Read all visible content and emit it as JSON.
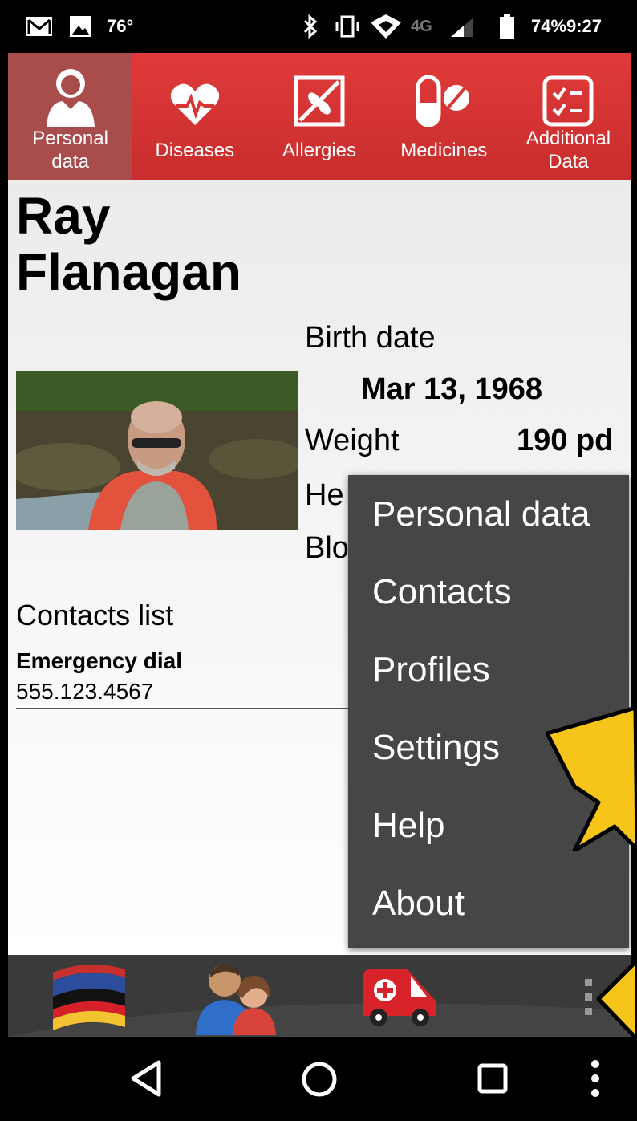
{
  "status": {
    "temperature": "76°",
    "network": "4G",
    "battery": "74%",
    "time": "9:27"
  },
  "tabs": [
    {
      "label": "Personal\ndata",
      "icon": "person-icon"
    },
    {
      "label": "Diseases",
      "icon": "heart-icon"
    },
    {
      "label": "Allergies",
      "icon": "allergy-icon"
    },
    {
      "label": "Medicines",
      "icon": "pill-icon"
    },
    {
      "label": "Additional\nData",
      "icon": "checklist-icon"
    }
  ],
  "profile": {
    "name_first": "Ray",
    "name_last": "Flanagan",
    "birth_label": "Birth date",
    "birth_value": "Mar 13, 1968",
    "weight_label": "Weight",
    "weight_value": "190 pd",
    "height_label_partial": "He",
    "blood_label_partial": "Blo"
  },
  "contacts": {
    "heading": "Contacts list",
    "emergency_label": "Emergency dial",
    "emergency_number": "555.123.4567"
  },
  "menu": {
    "items": [
      "Personal data",
      "Contacts",
      "Profiles",
      "Settings",
      "Help",
      "About"
    ]
  },
  "colors": {
    "header_red": "#d83434",
    "menu_bg": "#464646",
    "arrow_yellow": "#f7c51a"
  }
}
